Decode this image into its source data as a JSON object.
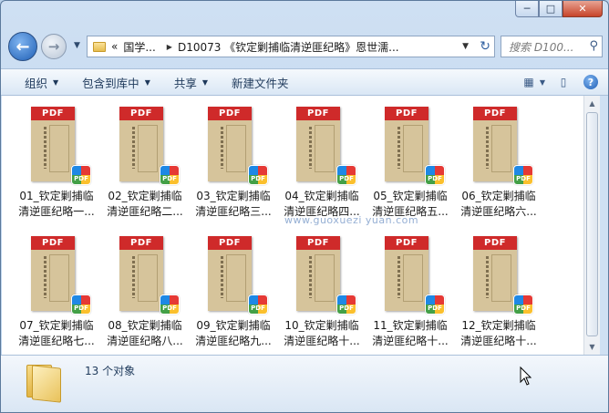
{
  "window_controls": {
    "minimize": "─",
    "maximize": "□",
    "close": "✕"
  },
  "nav": {
    "back_glyph": "←",
    "forward_glyph": "→",
    "history_glyph": "▼",
    "address_prefix": "«",
    "breadcrumbs": [
      "国学...",
      "D10073 《钦定剿捕临清逆匪纪略》恩世濡..."
    ],
    "crumb_separator": "▶",
    "address_dropdown": "▼",
    "refresh_glyph": "↻",
    "search_placeholder": "搜索 D100...",
    "search_glyph": "⚲"
  },
  "toolbar": {
    "organize": "组织",
    "include_in_library": "包含到库中",
    "share": "共享",
    "new_folder": "新建文件夹",
    "caret": "▼",
    "view_glyph": "▦",
    "pane_glyph": "▯",
    "help_glyph": "?"
  },
  "files": [
    {
      "line1": "01_钦定剿捕临",
      "line2": "清逆匪纪略一..."
    },
    {
      "line1": "02_钦定剿捕临",
      "line2": "清逆匪纪略二..."
    },
    {
      "line1": "03_钦定剿捕临",
      "line2": "清逆匪纪略三..."
    },
    {
      "line1": "04_钦定剿捕临",
      "line2": "清逆匪纪略四..."
    },
    {
      "line1": "05_钦定剿捕临",
      "line2": "清逆匪纪略五..."
    },
    {
      "line1": "06_钦定剿捕临",
      "line2": "清逆匪纪略六..."
    },
    {
      "line1": "07_钦定剿捕临",
      "line2": "清逆匪纪略七..."
    },
    {
      "line1": "08_钦定剿捕临",
      "line2": "清逆匪纪略八..."
    },
    {
      "line1": "09_钦定剿捕临",
      "line2": "清逆匪纪略九..."
    },
    {
      "line1": "10_钦定剿捕临",
      "line2": "清逆匪纪略十..."
    },
    {
      "line1": "11_钦定剿捕临",
      "line2": "清逆匪纪略十..."
    },
    {
      "line1": "12_钦定剿捕临",
      "line2": "清逆匪纪略十..."
    }
  ],
  "thumb_band_text": "PDF",
  "badge_text": "PDF",
  "watermark": "www.guoxuezi yuan.com",
  "status": {
    "count_text": "13 个对象"
  },
  "scroll": {
    "up": "▲",
    "down": "▼"
  }
}
